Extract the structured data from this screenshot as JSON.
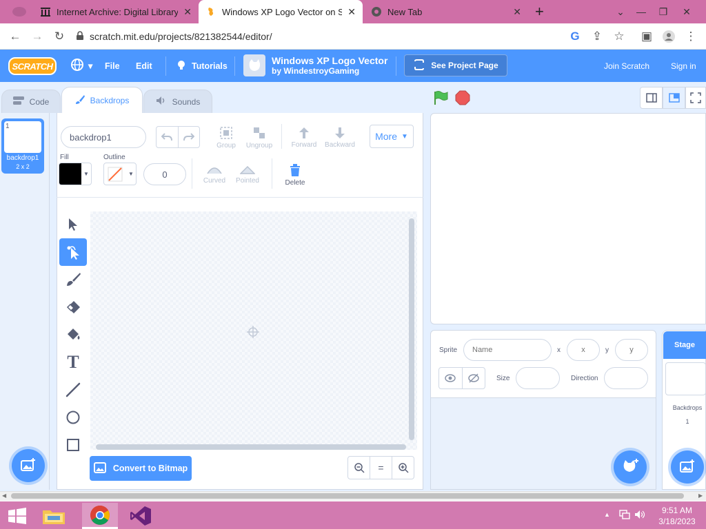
{
  "browser": {
    "tabs": [
      {
        "title": "Internet Archive: Digital Library o",
        "active": false
      },
      {
        "title": "Windows XP Logo Vector on Scra",
        "active": true
      },
      {
        "title": "New Tab",
        "active": false
      }
    ],
    "new_tab": "+",
    "url": "scratch.mit.edu/projects/821382544/editor/"
  },
  "menubar": {
    "logo": "SCRATCH",
    "file": "File",
    "edit": "Edit",
    "tutorials": "Tutorials",
    "project_title": "Windows XP Logo Vector",
    "project_author": "by WindestroyGaming",
    "see_project_page": "See Project Page",
    "join": "Join Scratch",
    "signin": "Sign in"
  },
  "editor_tabs": {
    "code": "Code",
    "backdrops": "Backdrops",
    "sounds": "Sounds"
  },
  "costume": {
    "index": "1",
    "name": "backdrop1",
    "size": "2 x 2"
  },
  "paint": {
    "name_value": "backdrop1",
    "group": "Group",
    "ungroup": "Ungroup",
    "forward": "Forward",
    "backward": "Backward",
    "more": "More",
    "fill_label": "Fill",
    "outline_label": "Outline",
    "outline_width": "0",
    "curved": "Curved",
    "pointed": "Pointed",
    "delete": "Delete",
    "convert": "Convert to Bitmap",
    "zoom_reset": "="
  },
  "sprite_info": {
    "sprite_label": "Sprite",
    "name_placeholder": "Name",
    "x_label": "x",
    "x_placeholder": "x",
    "y_label": "y",
    "y_placeholder": "y",
    "size_label": "Size",
    "direction_label": "Direction"
  },
  "stage_panel": {
    "title": "Stage",
    "backdrops_label": "Backdrops",
    "backdrops_count": "1"
  },
  "taskbar": {
    "time": "9:51 AM",
    "date": "3/18/2023"
  },
  "colors": {
    "scratch_blue": "#4c97ff",
    "tab_strip": "#cf6fa7",
    "taskbar": "#d27ab0",
    "fill": "#000000",
    "outline": "#ff6e3b"
  }
}
